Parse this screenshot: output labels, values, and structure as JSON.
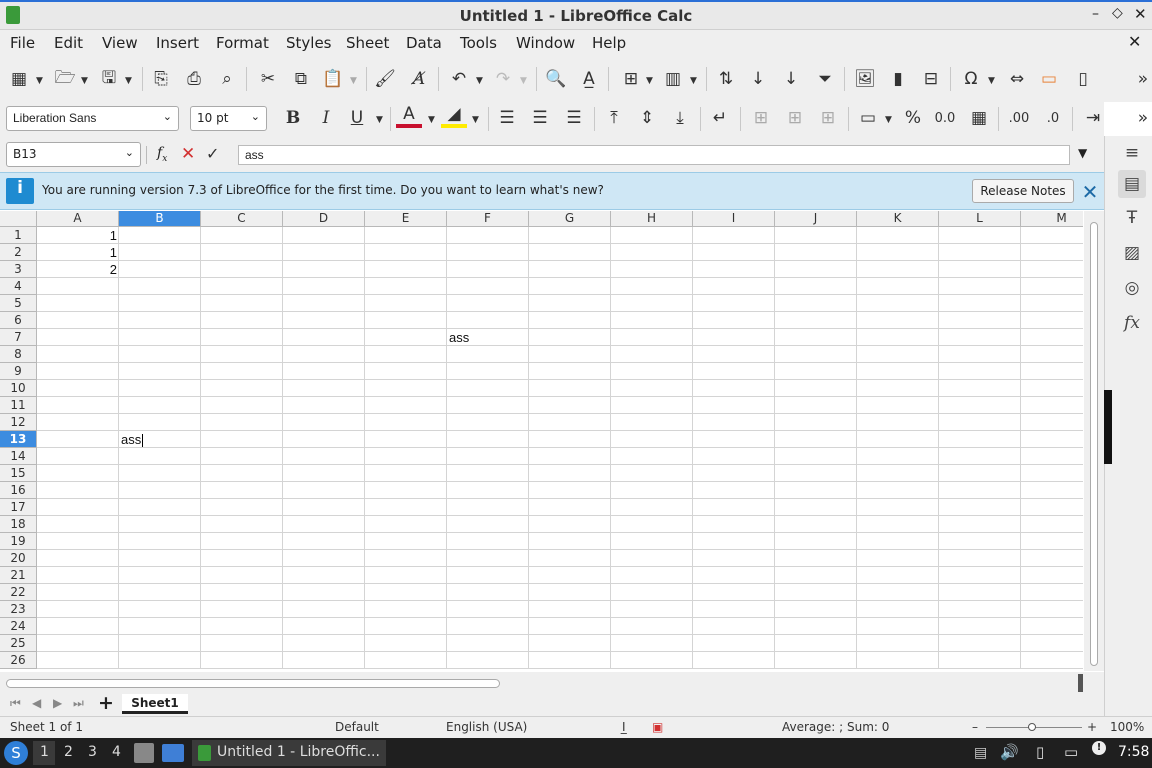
{
  "window": {
    "title": "Untitled 1 - LibreOffice Calc"
  },
  "menu": [
    "File",
    "Edit",
    "View",
    "Insert",
    "Format",
    "Styles",
    "Sheet",
    "Data",
    "Tools",
    "Window",
    "Help"
  ],
  "format_bar": {
    "font_name": "Liberation Sans",
    "font_size": "10 pt"
  },
  "formula_bar": {
    "name_box": "B13",
    "content": "ass"
  },
  "infobar": {
    "message": "You are running version 7.3 of LibreOffice for the first time. Do you want to learn what's new?",
    "button": "Release Notes"
  },
  "columns": [
    "A",
    "B",
    "C",
    "D",
    "E",
    "F",
    "G",
    "H",
    "I",
    "J",
    "K",
    "L",
    "M"
  ],
  "selected_column": "B",
  "rows": [
    "1",
    "2",
    "3",
    "4",
    "5",
    "6",
    "7",
    "8",
    "9",
    "10",
    "11",
    "12",
    "13",
    "14",
    "15",
    "16",
    "17",
    "18",
    "19",
    "20",
    "21",
    "22",
    "23",
    "24",
    "25",
    "26"
  ],
  "selected_row": "13",
  "cells": {
    "A1": "1",
    "A2": "1",
    "A3": "2",
    "F7": "ass",
    "B13": "ass"
  },
  "sheet_tabs": [
    "Sheet1"
  ],
  "status": {
    "sheet": "Sheet 1 of 1",
    "style": "Default",
    "language": "English (USA)",
    "sum": "Average: ; Sum: 0",
    "zoom": "100%"
  },
  "taskbar": {
    "workspaces": [
      "1",
      "2",
      "3",
      "4"
    ],
    "task": "Untitled 1 - LibreOffic...",
    "clock": "7:58"
  },
  "colors": {
    "accent": "#3c8ce0",
    "infobar": "#cfe7f5",
    "taskbar": "#1f1f1f"
  }
}
